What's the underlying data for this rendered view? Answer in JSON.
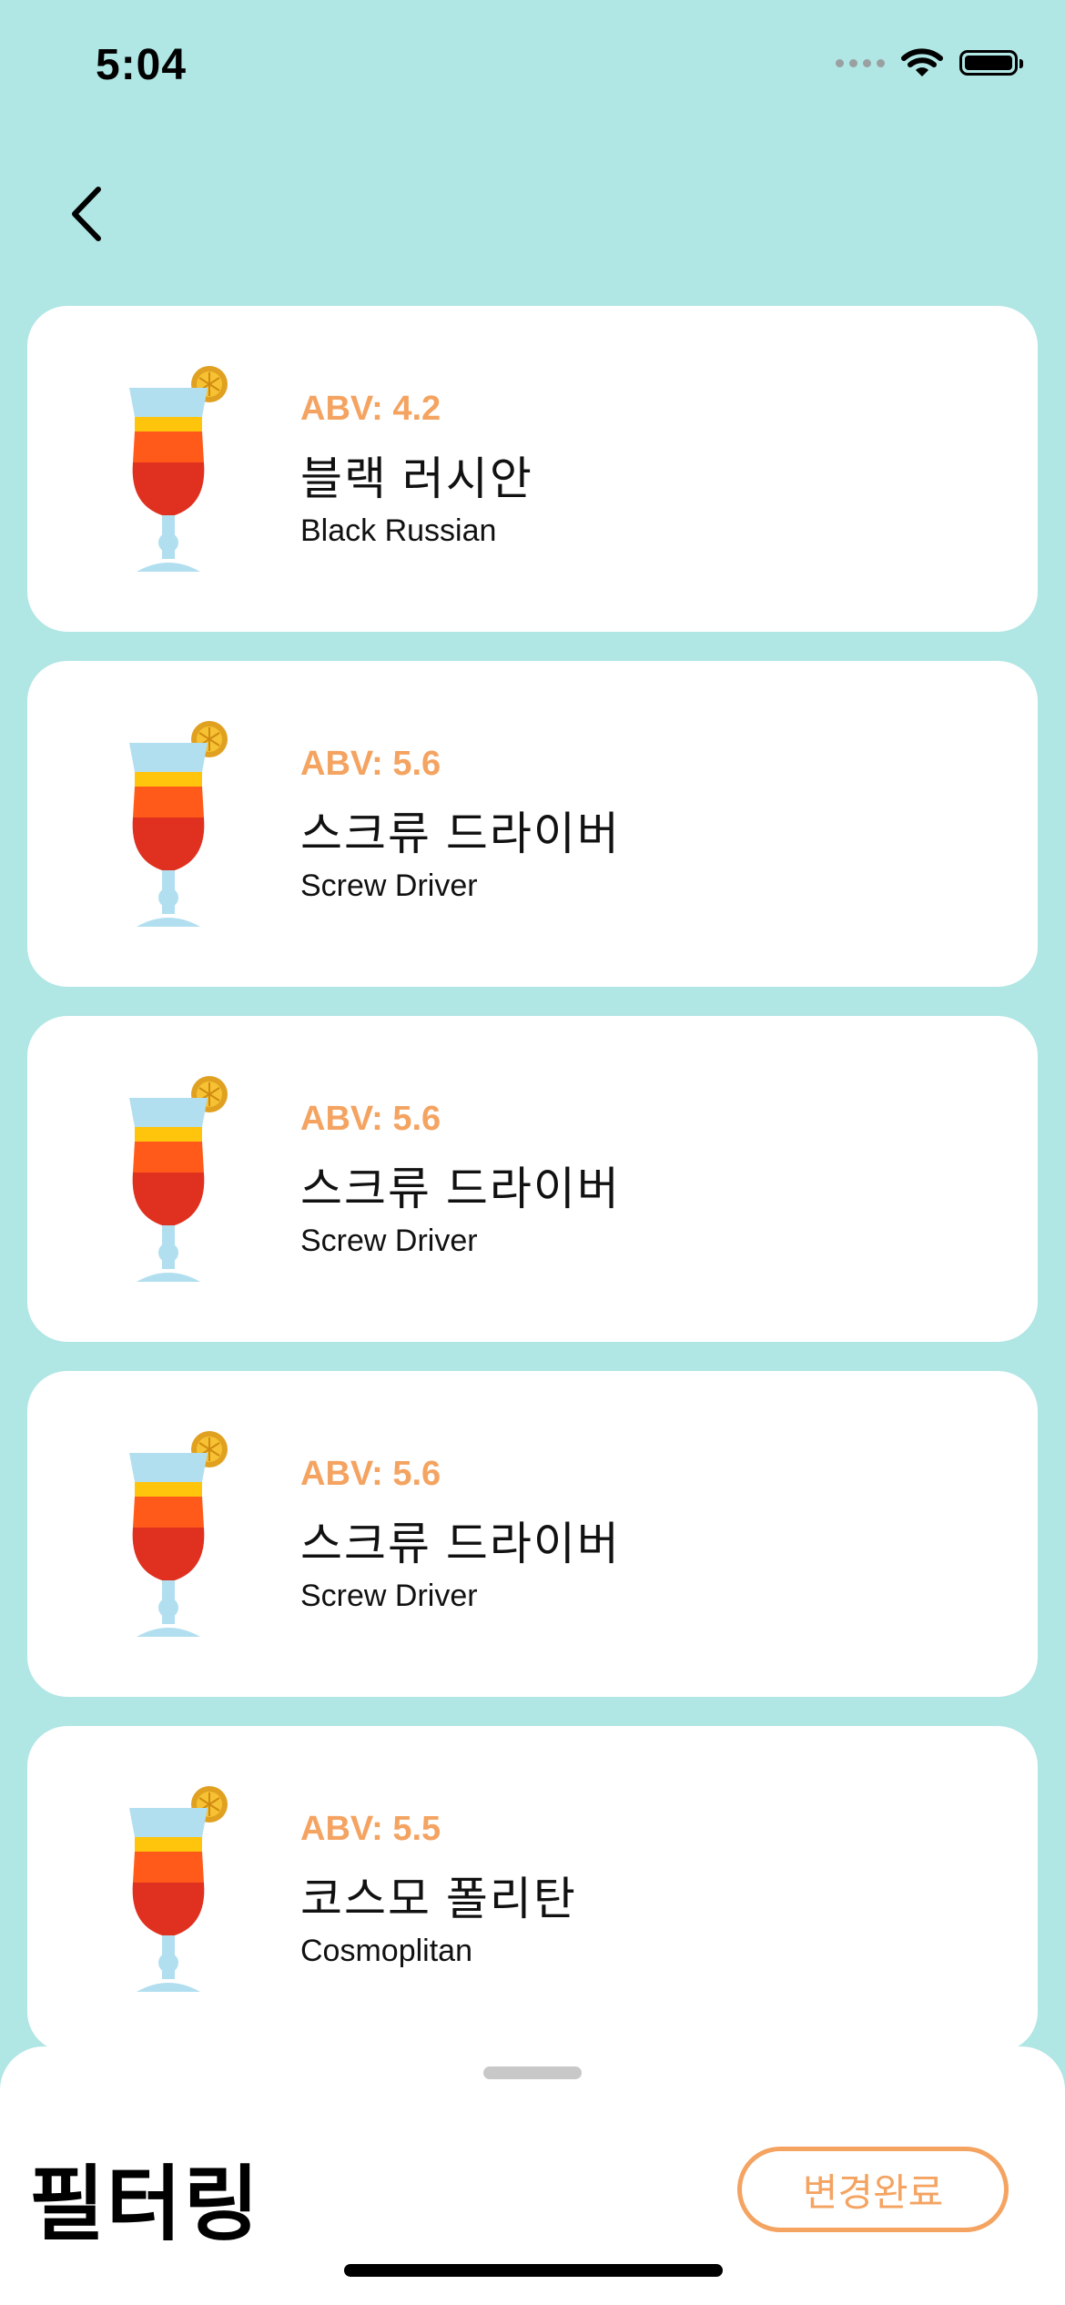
{
  "status_bar": {
    "time": "5:04"
  },
  "navigation": {
    "back_icon": "chevron-left-icon"
  },
  "cocktails": [
    {
      "abv": "ABV: 4.2",
      "name_ko": "블랙 러시안",
      "name_en": "Black Russian"
    },
    {
      "abv": "ABV: 5.6",
      "name_ko": "스크류 드라이버",
      "name_en": "Screw Driver"
    },
    {
      "abv": "ABV: 5.6",
      "name_ko": "스크류 드라이버",
      "name_en": "Screw Driver"
    },
    {
      "abv": "ABV: 5.6",
      "name_ko": "스크류 드라이버",
      "name_en": "Screw Driver"
    },
    {
      "abv": "ABV: 5.5",
      "name_ko": "코스모 폴리탄",
      "name_en": "Cosmoplitan"
    }
  ],
  "filter_sheet": {
    "title": "필터링",
    "done_label": "변경완료"
  },
  "colors": {
    "background": "#b0e6e4",
    "accent": "#f4a361",
    "card": "#ffffff"
  }
}
